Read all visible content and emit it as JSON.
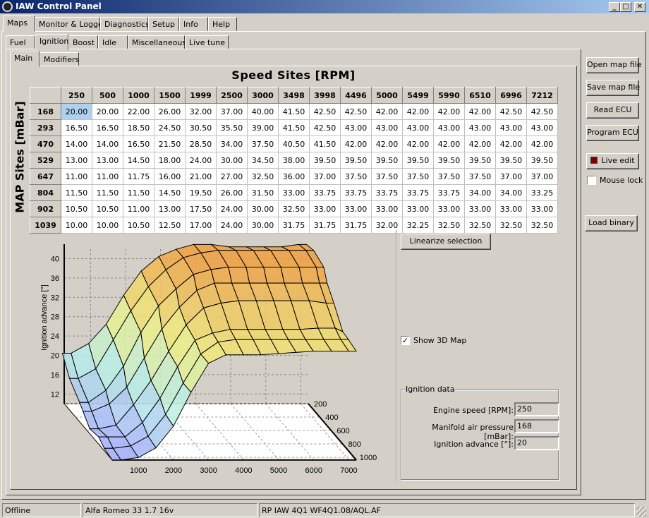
{
  "window": {
    "title": "IAW Control Panel",
    "minimize": "_",
    "maximize": "□",
    "close": "✕"
  },
  "main_tabs": [
    "Maps",
    "Monitor & Logger",
    "Diagnostics",
    "Setup",
    "Info",
    "Help"
  ],
  "map_tabs": [
    "Fuel",
    "Ignition",
    "Boost",
    "Idle",
    "Miscellaneous",
    "Live tune"
  ],
  "sub_tabs": [
    "Main",
    "Modifiers"
  ],
  "map": {
    "x_title": "Speed Sites [RPM]",
    "y_title": "MAP Sites [mBar]",
    "rpm": [
      250,
      500,
      1000,
      1500,
      1999,
      2500,
      3000,
      3498,
      3998,
      4496,
      5000,
      5499,
      5990,
      6510,
      6996,
      7212
    ],
    "map": [
      168,
      293,
      470,
      529,
      647,
      804,
      902,
      1039
    ],
    "values": [
      [
        "20.00",
        "20.00",
        "22.00",
        "26.00",
        "32.00",
        "37.00",
        "40.00",
        "41.50",
        "42.50",
        "42.50",
        "42.00",
        "42.00",
        "42.00",
        "42.00",
        "42.50",
        "42.50"
      ],
      [
        "16.50",
        "16.50",
        "18.50",
        "24.50",
        "30.50",
        "35.50",
        "39.00",
        "41.50",
        "42.50",
        "43.00",
        "43.00",
        "43.00",
        "43.00",
        "43.00",
        "43.00",
        "43.00"
      ],
      [
        "14.00",
        "14.00",
        "16.50",
        "21.50",
        "28.50",
        "34.00",
        "37.50",
        "40.50",
        "41.50",
        "42.00",
        "42.00",
        "42.00",
        "42.00",
        "42.00",
        "42.00",
        "42.00"
      ],
      [
        "13.00",
        "13.00",
        "14.50",
        "18.00",
        "24.00",
        "30.00",
        "34.50",
        "38.00",
        "39.50",
        "39.50",
        "39.50",
        "39.50",
        "39.50",
        "39.50",
        "39.50",
        "39.50"
      ],
      [
        "11.00",
        "11.00",
        "11.75",
        "16.00",
        "21.00",
        "27.00",
        "32.50",
        "36.00",
        "37.00",
        "37.50",
        "37.50",
        "37.50",
        "37.50",
        "37.50",
        "37.00",
        "37.00"
      ],
      [
        "11.50",
        "11.50",
        "11.50",
        "14.50",
        "19.50",
        "26.00",
        "31.50",
        "33.00",
        "33.75",
        "33.75",
        "33.75",
        "33.75",
        "33.75",
        "34.00",
        "34.00",
        "33.25"
      ],
      [
        "10.50",
        "10.50",
        "11.00",
        "13.00",
        "17.50",
        "24.00",
        "30.00",
        "32.50",
        "33.00",
        "33.00",
        "33.00",
        "33.00",
        "33.00",
        "33.00",
        "33.00",
        "33.00"
      ],
      [
        "10.00",
        "10.00",
        "10.50",
        "12.50",
        "17.00",
        "24.00",
        "30.00",
        "31.75",
        "31.75",
        "31.75",
        "32.00",
        "32.25",
        "32.50",
        "32.50",
        "32.50",
        "32.50"
      ]
    ],
    "selected_cell": [
      0,
      0
    ]
  },
  "plot": {
    "z_label": "Ignition advance [°]",
    "z_ticks": [
      "12",
      "16",
      "20",
      "24",
      "28",
      "32",
      "36",
      "40"
    ],
    "x_ticks": [
      "1000",
      "2000",
      "3000",
      "4000",
      "5000",
      "6000",
      "7000"
    ],
    "y_ticks": [
      "200",
      "400",
      "600",
      "800",
      "1000"
    ],
    "colors": {
      "low": "#9fa8f8",
      "mid_low": "#b8f0e8",
      "mid": "#f0f080",
      "high": "#f0a040"
    }
  },
  "controls": {
    "linearize": "Linearize selection",
    "show_3d": "Show 3D Map",
    "show_3d_checked": true
  },
  "ignition_data": {
    "title": "Ignition data",
    "engine_speed_label": "Engine speed [RPM]:",
    "engine_speed": "250",
    "map_label": "Manifold air pressure [mBar]:",
    "map_value": "168",
    "advance_label": "Ignition advance [°]:",
    "advance": "20"
  },
  "side": {
    "open": "Open map file",
    "save": "Save map file",
    "read": "Read ECU",
    "program": "Program ECU",
    "live_edit": "Live edit",
    "live_color": "#800000",
    "mouse_lock": "Mouse lock",
    "mouse_lock_checked": false,
    "load_binary": "Load binary"
  },
  "status": [
    "Offline",
    "Alfa Romeo 33 1.7 16v",
    "RP IAW 4Q1 WF4Q1.08/AQL.AF"
  ]
}
